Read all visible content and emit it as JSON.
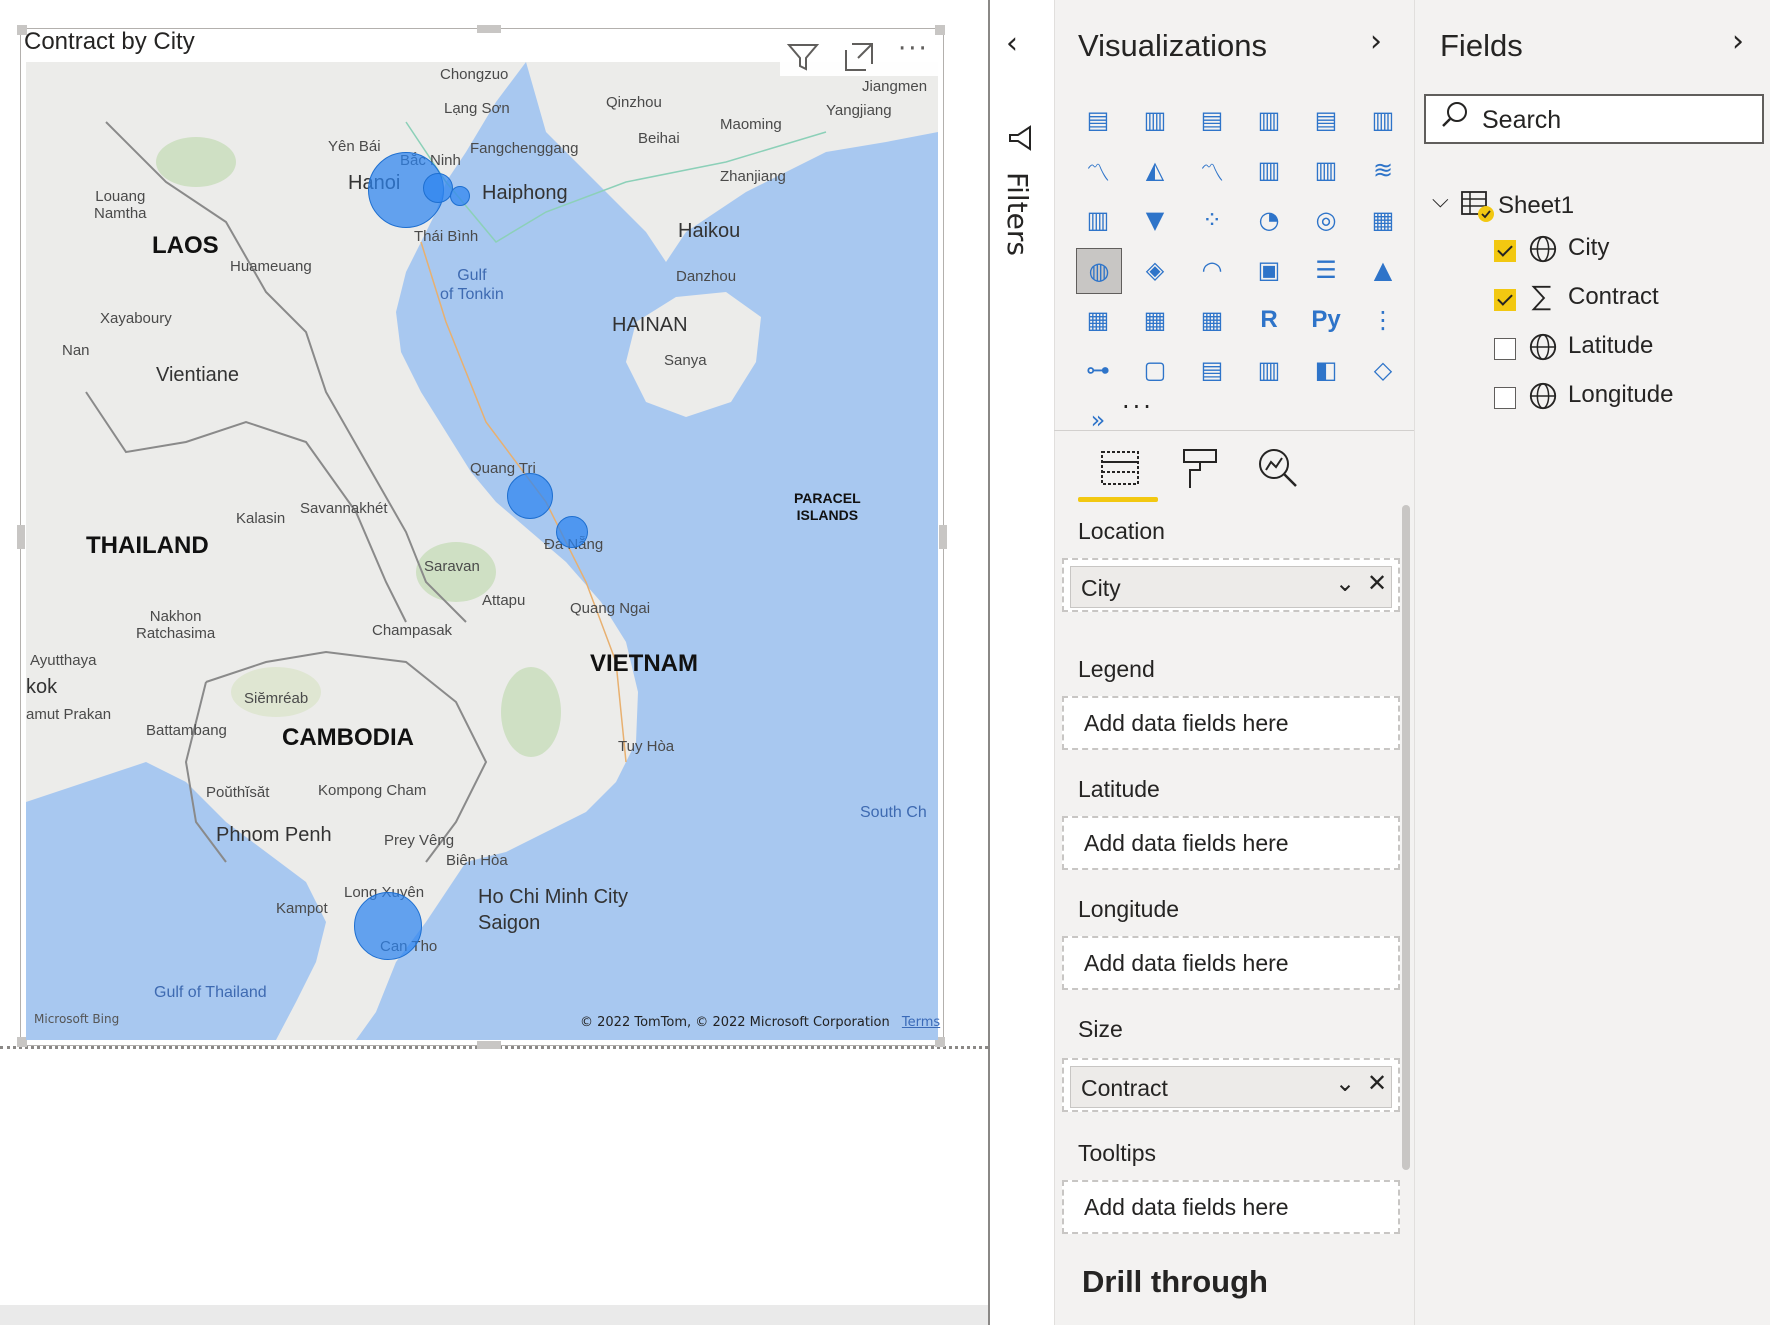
{
  "visual": {
    "title": "Contract by City",
    "header_icons": [
      "filter-icon",
      "focus-mode-icon",
      "more-options-icon"
    ]
  },
  "map": {
    "countries": [
      "LAOS",
      "THAILAND",
      "CAMBODIA",
      "VIETNAM",
      "HAINAN"
    ],
    "place_labels": {
      "chongzuo": "Chongzuo",
      "langson": "Lạng Sơn",
      "qinzhou": "Qinzhou",
      "jiangmen": "Jiangmen",
      "maoming": "Maoming",
      "yangjiang": "Yangjiang",
      "beihai": "Beihai",
      "yenbai": "Yên Bái",
      "bacninh": "Bắc Ninh",
      "fangchenggang": "Fangchenggang",
      "zhanjiang": "Zhanjiang",
      "hanoi": "Hanoi",
      "haiphong": "Haiphong",
      "louang": "Louang\nNamtha",
      "thaibinh": "Thái Bình",
      "haikou": "Haikou",
      "danzhou": "Danzhou",
      "huameuang": "Huameuang",
      "sanya": "Sanya",
      "xayaboury": "Xayaboury",
      "nan": "Nan",
      "vientiane": "Vientiane",
      "quangtri": "Quang Tri",
      "savannakhet": "Savannakhét",
      "kalasin": "Kalasin",
      "danang": "Đà Nẵng",
      "saravan": "Saravan",
      "attapu": "Attapu",
      "quangngai": "Quang Ngai",
      "nakhon": "Nakhon\nRatchasima",
      "champasak": "Champasak",
      "ayutthaya": "Ayutthaya",
      "bangkok": "kok",
      "samut": "amut Prakan",
      "siemreab": "Siĕmréab",
      "battambang": "Battambang",
      "tuyhoa": "Tuy Hòa",
      "pouthisat": "Poŭthĭsăt",
      "kompongcham": "Kompong Cham",
      "phnompenh": "Phnom Penh",
      "preyveng": "Prey Vêng",
      "bienhoa": "Biên Hòa",
      "kampot": "Kampot",
      "longxuyen": "Long Xuyên",
      "hcmc": "Ho Chi Minh City",
      "saigon": "Saigon",
      "cantho": "Can Tho"
    },
    "water_labels": {
      "tonkin": "Gulf\nof Tonkin",
      "southchina": "South Ch",
      "thailand_gulf": "Gulf of Thailand"
    },
    "island_label": "PARACEL\nISLANDS",
    "bubbles": [
      {
        "city": "Hanoi",
        "size": "large"
      },
      {
        "city": "Bắc Ninh",
        "size": "small"
      },
      {
        "city": "Haiphong",
        "size": "small"
      },
      {
        "city": "Quang Tri",
        "size": "medium"
      },
      {
        "city": "Đà Nẵng",
        "size": "small"
      },
      {
        "city": "Long Xuyên",
        "size": "large"
      }
    ],
    "attribution": "© 2022 TomTom, © 2022 Microsoft Corporation",
    "terms": "Terms",
    "bing": "Microsoft Bing"
  },
  "filters": {
    "label": "Filters"
  },
  "visualizations": {
    "title": "Visualizations",
    "more": "...",
    "tabs": [
      "fields-tab",
      "format-tab",
      "analytics-tab"
    ],
    "wells": [
      {
        "label": "Location",
        "field": "City"
      },
      {
        "label": "Legend",
        "placeholder": "Add data fields here"
      },
      {
        "label": "Latitude",
        "placeholder": "Add data fields here"
      },
      {
        "label": "Longitude",
        "placeholder": "Add data fields here"
      },
      {
        "label": "Size",
        "field": "Contract"
      },
      {
        "label": "Tooltips",
        "placeholder": "Add data fields here"
      }
    ],
    "drill_through": "Drill through"
  },
  "fields": {
    "title": "Fields",
    "search_placeholder": "Search",
    "table": "Sheet1",
    "items": [
      {
        "name": "City",
        "checked": true,
        "type": "geo"
      },
      {
        "name": "Contract",
        "checked": true,
        "type": "sum"
      },
      {
        "name": "Latitude",
        "checked": false,
        "type": "geo"
      },
      {
        "name": "Longitude",
        "checked": false,
        "type": "geo"
      }
    ]
  },
  "colors": {
    "accent_yellow": "#f2c811",
    "bubble_blue": "#2d84f0",
    "sea": "#a8c8f0",
    "land": "#ececea"
  }
}
